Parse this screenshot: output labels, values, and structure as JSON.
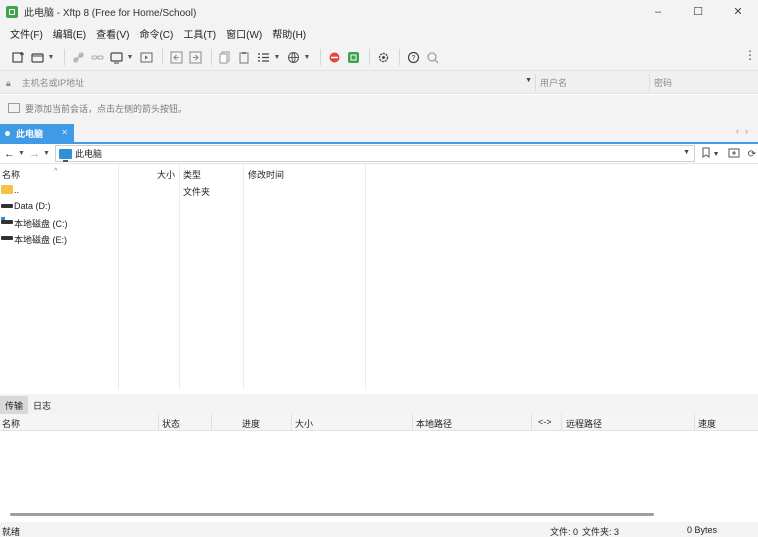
{
  "window": {
    "title": "此电脑 - Xftp 8 (Free for Home/School)",
    "minimize": "–",
    "maximize": "☐",
    "close": "✕"
  },
  "menu": [
    "文件(F)",
    "编辑(E)",
    "查看(V)",
    "命令(C)",
    "工具(T)",
    "窗口(W)",
    "帮助(H)"
  ],
  "address": {
    "host_placeholder": "主机名或IP地址",
    "user_placeholder": "用户名",
    "password_placeholder": "密码"
  },
  "hint_text": "要添加当前会话，点击左侧的箭头按钮。",
  "tab": {
    "label": "此电脑",
    "close": "✕"
  },
  "nav": {
    "path": "此电脑"
  },
  "file_list": {
    "columns": [
      "名称",
      "大小",
      "类型",
      "修改时间"
    ],
    "rows": [
      {
        "name": "..",
        "type": "文件夹",
        "icon": "folder-icon"
      },
      {
        "name": "Data (D:)",
        "type": "",
        "icon": "drive-icon"
      },
      {
        "name": "本地磁盘 (C:)",
        "type": "",
        "icon": "system-drive-icon"
      },
      {
        "name": "本地磁盘 (E:)",
        "type": "",
        "icon": "drive-icon"
      }
    ]
  },
  "bottom_tabs": [
    "传输",
    "日志"
  ],
  "transfer_columns": [
    "名称",
    "状态",
    "进度",
    "大小",
    "本地路径",
    "<->",
    "远程路径",
    "速度"
  ],
  "status": {
    "left": "就绪",
    "files": "文件: 0",
    "folders": "文件夹: 3",
    "bytes": "0 Bytes"
  },
  "colors": {
    "accent": "#3f9be5",
    "folder": "#f4c245",
    "app_icon": "#3fa34d"
  }
}
